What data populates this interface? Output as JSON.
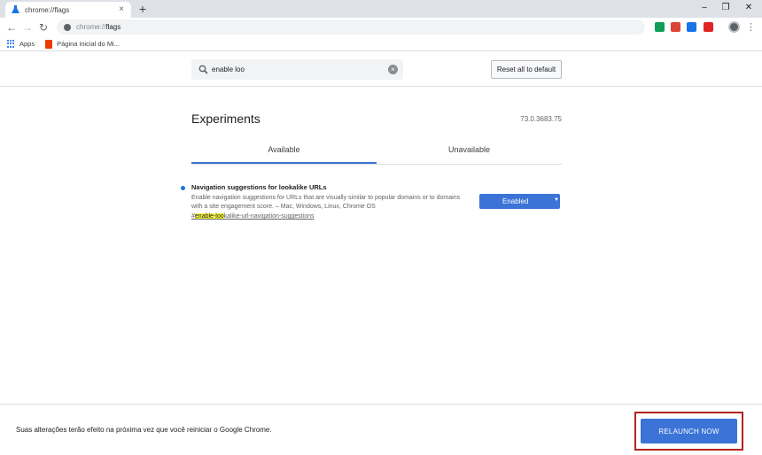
{
  "browser": {
    "tab": {
      "title": "chrome://flags",
      "close": "×"
    },
    "new_tab": "+",
    "window_controls": {
      "minimize": "–",
      "restore": "❐",
      "close": "✕"
    },
    "nav": {
      "back": "←",
      "forward": "→",
      "reload": "↻"
    },
    "omnibox": {
      "scheme": "chrome://",
      "path": "flags"
    },
    "menu": "⋮"
  },
  "bookmarks": {
    "items": [
      {
        "label": "Apps",
        "icon": "apps-grid-icon"
      },
      {
        "label": "Página inicial do Mi...",
        "icon": "office-icon"
      }
    ]
  },
  "search": {
    "value": "enable loo",
    "reset_label": "Reset all to default"
  },
  "experiments": {
    "title": "Experiments",
    "version": "73.0.3683.75",
    "tabs": [
      {
        "label": "Available",
        "active": true
      },
      {
        "label": "Unavailable",
        "active": false
      }
    ],
    "flags": [
      {
        "name": "Navigation suggestions for lookalike URLs",
        "description": "Enable navigation suggestions for URLs that are visually similar to popular domains or to domains with a site engagement score. – Mac, Windows, Linux, Chrome OS",
        "link_prefix": "#",
        "link_highlight": "enable-loo",
        "link_rest": "kalike-url-navigation-suggestions",
        "selected": "Enabled"
      }
    ]
  },
  "bottom": {
    "message": "Suas alterações terão efeito na próxima vez que você reiniciar o Google Chrome.",
    "relaunch_label": "RELAUNCH NOW"
  },
  "colors": {
    "accent": "#3b73d6",
    "highlight": "#f7f73b",
    "annotation_frame": "#b3231f"
  }
}
